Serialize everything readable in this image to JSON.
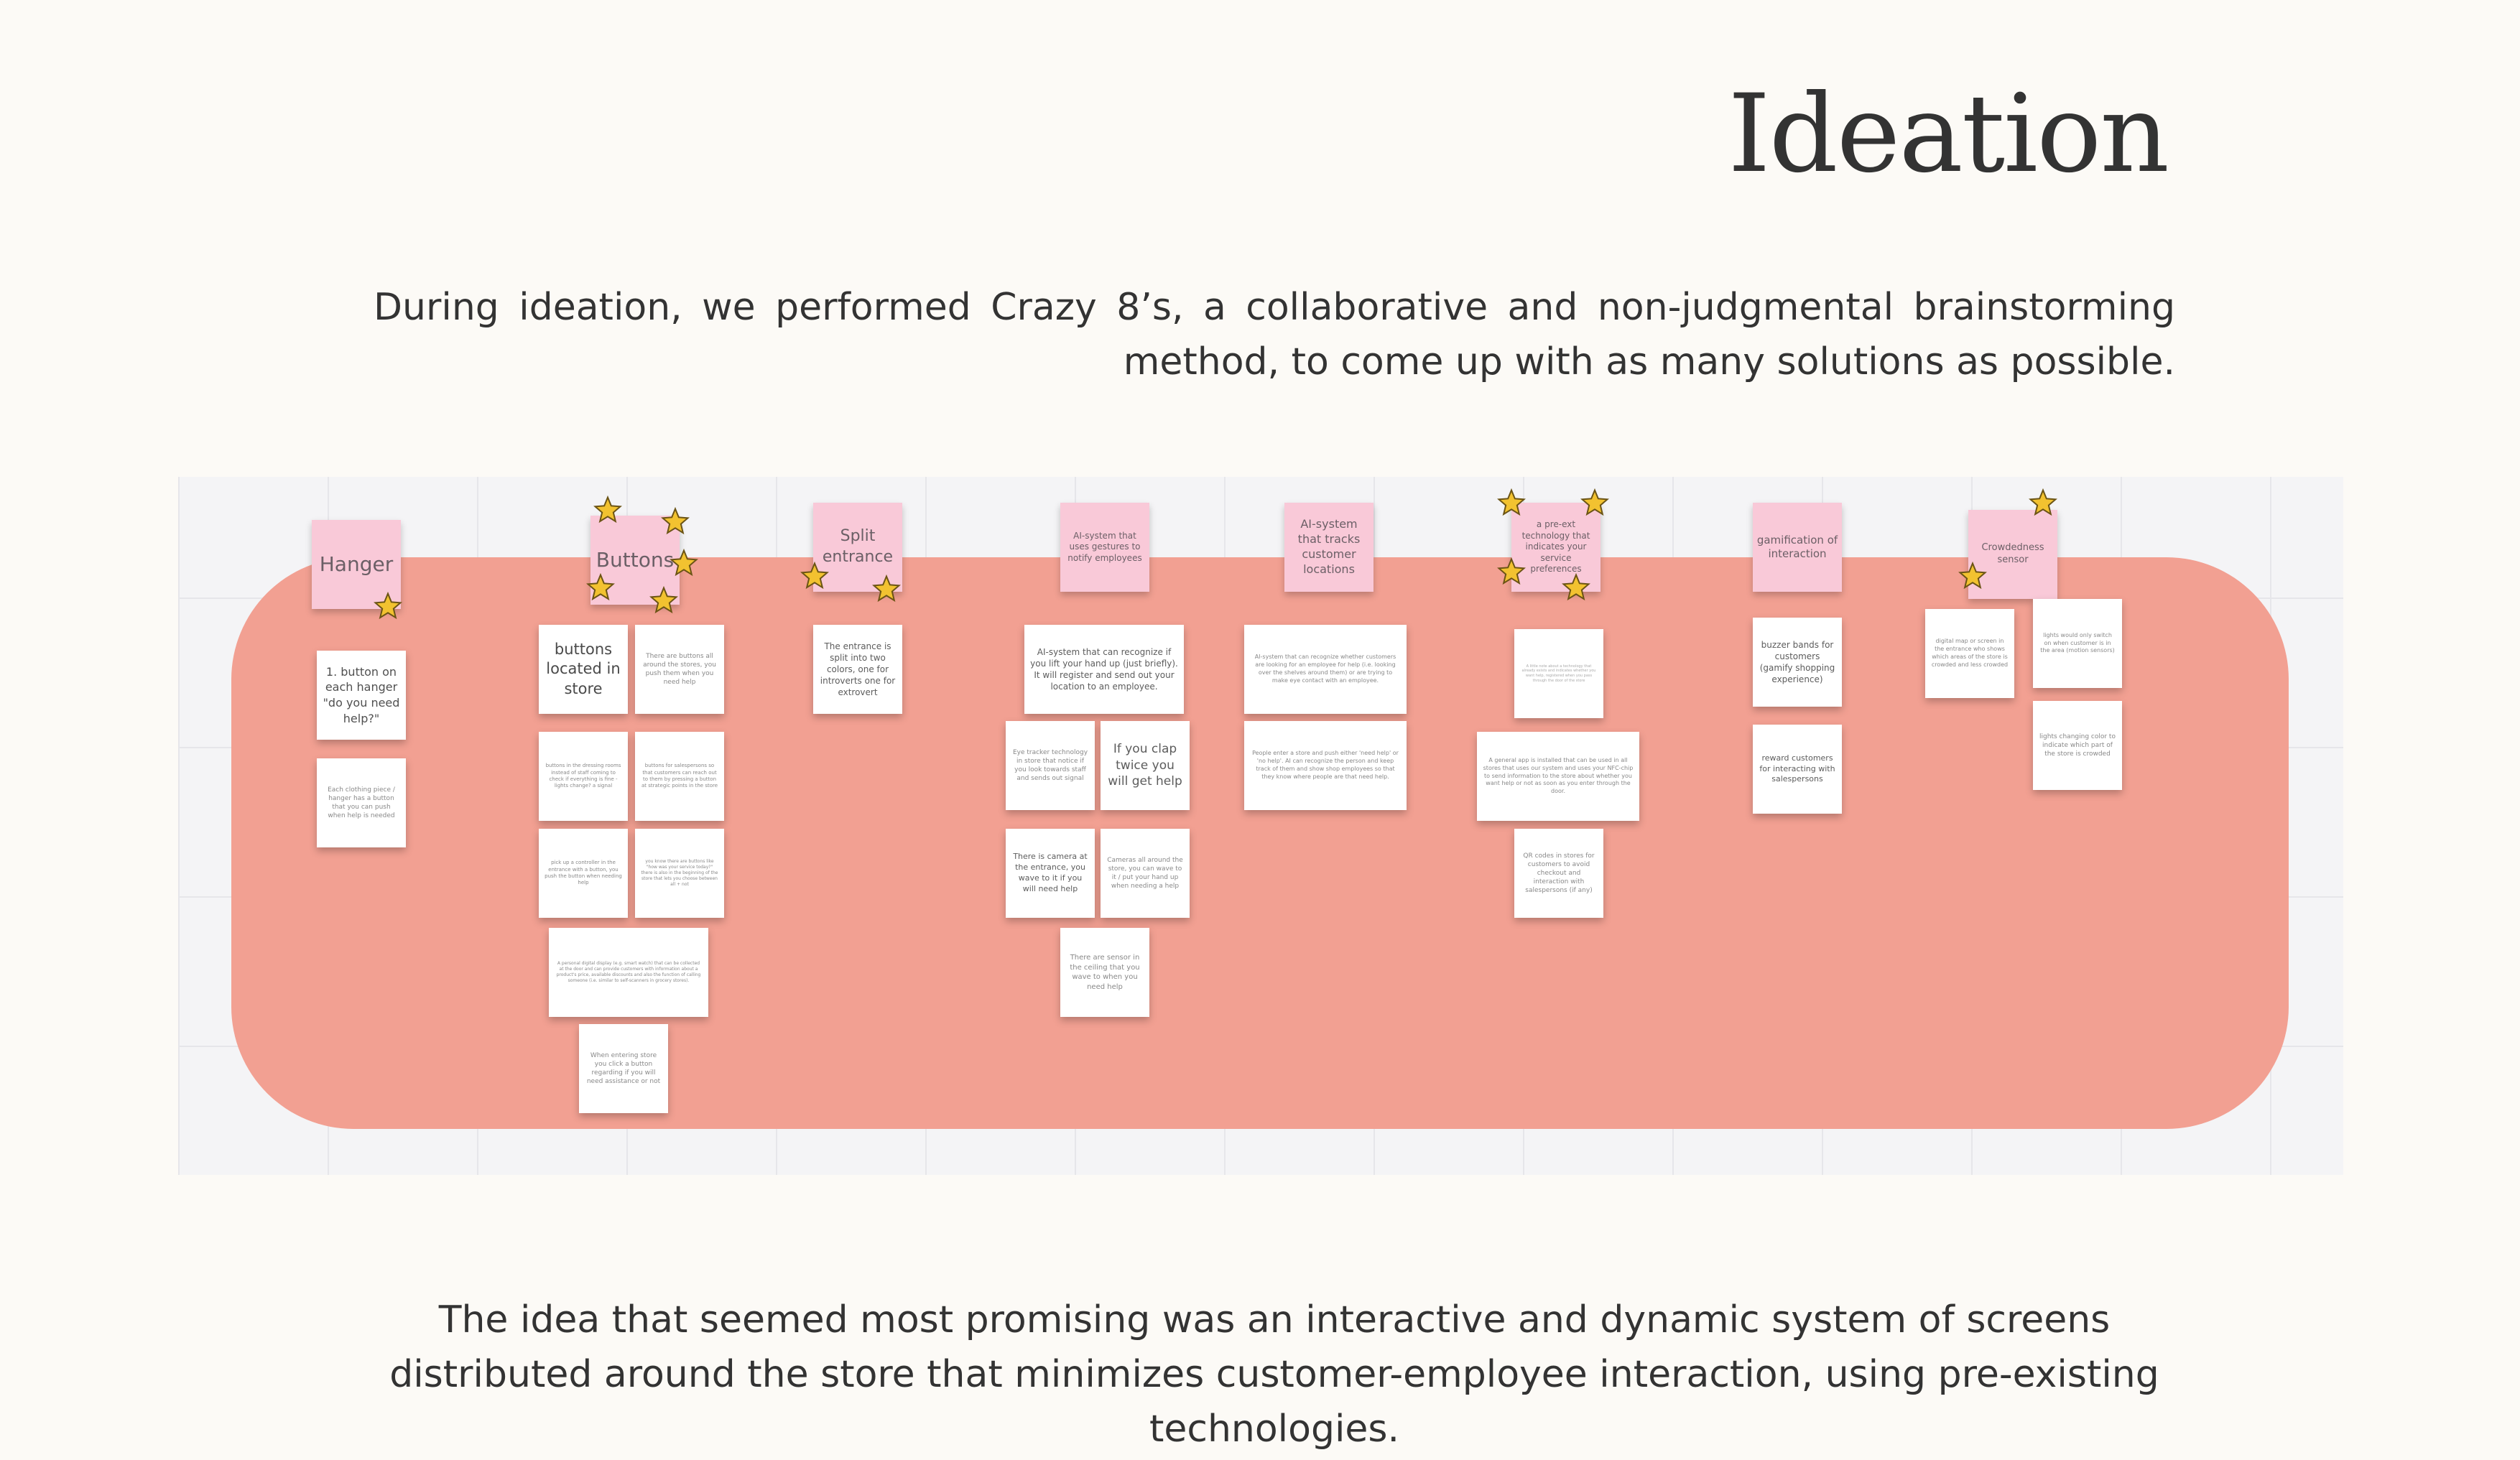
{
  "page": {
    "title": "Ideation",
    "intro": "During ideation, we performed Crazy 8’s, a collaborative and non-judgmental brainstorming method, to come up with as many solutions as possible.",
    "outro": "The idea that seemed most promising was an interactive and dynamic system of screens distributed around the store that minimizes customer-employee interaction, using pre-existing technologies."
  },
  "board": {
    "headers": {
      "hanger": "Hanger",
      "buttons": "Buttons",
      "split": "Split entrance",
      "gestures": "AI-system that uses gestures to notify employees",
      "tracks": "AI-system that tracks customer locations",
      "preexist": "a pre-ext technology that indicates your service preferences",
      "gamification": "gamification of interaction",
      "crowdedness": "Crowdedness sensor"
    },
    "notes": {
      "hanger1": "1. button on each hanger \"do you need help?\"",
      "hanger2": "Each clothing piece / hanger has a button that you can push when help is needed",
      "buttons1": "buttons located in store",
      "buttons2": "There are buttons all around the stores, you push them when you need help",
      "buttons3": "buttons in the dressing rooms instead of staff coming to check if everything is fine - lights change? a signal",
      "buttons4": "buttons for salespersons so that customers can reach out to them by pressing a button at strategic points in the store",
      "buttons5": "pick up a controller in the entrance with a button, you push the button when needing help",
      "buttons6": "you know there are buttons like \"how was your service today?\" there is also in the beginning of the store that lets you choose between all + not",
      "buttons7": "A personal digital display (e.g. smart watch) that can be collected at the door and can provide customers with information about a product's price, available discounts and also the function of calling someone (i.e. similar to self-scanners in grocery stores).",
      "buttons8": "When entering store you click a button regarding if you will need assistance or not",
      "split1": "The entrance is split into two colors, one for introverts one for extrovert",
      "gestures1": "AI-system that can recognize if you lift your hand up (just briefly). It will register and send out your location to an employee.",
      "gestures2": "Eye tracker technology in store that notice if you look towards staff and sends out signal",
      "gestures3": "If you clap twice you will get help",
      "gestures4": "There is camera at the entrance, you wave to it if you will need help",
      "gestures5": "Cameras all around the store, you can wave to it / put your hand up when needing a help",
      "gestures6": "There are sensor in the ceiling that you wave to when you need help",
      "tracks1": "AI-system that can recognize whether customers are looking for an employee for help (i.e. looking over the shelves around them) or are trying to make eye contact with an employee.",
      "tracks2": "People enter a store and push either 'need help' or 'no help'. AI can recognize the person and keep track of them and show shop employees so that they know where people are that need help.",
      "preexist1": "A little note about a technology that already exists and indicates whether you want help, registered when you pass through the door of the store",
      "preexist2": "A general app is installed that can be used in all stores that uses our system and uses your NFC-chip to send information to the store about whether you want help or not as soon as you enter through the door.",
      "preexist3": "QR codes in stores for customers to avoid checkout and interaction with salespersons (if any)",
      "gamification1": "buzzer bands for customers (gamify shopping experience)",
      "gamification2": "reward customers for interacting with salespersons",
      "crowd1": "digital map or screen in the entrance who shows which areas of the store is crowded and less crowded",
      "crowd2": "lights would only switch on when customer is in the area (motion sensors)",
      "crowd3": "lights changing color to indicate which part of the store is crowded"
    }
  },
  "colors": {
    "background": "#fcfaf6",
    "zone": "#f2a092",
    "sticky_pink": "#f9c9d8",
    "sticky_white": "#ffffff",
    "star_fill": "#f2c230",
    "star_stroke": "#6b5415",
    "text": "#333333"
  },
  "icons": [
    "star-icon"
  ]
}
